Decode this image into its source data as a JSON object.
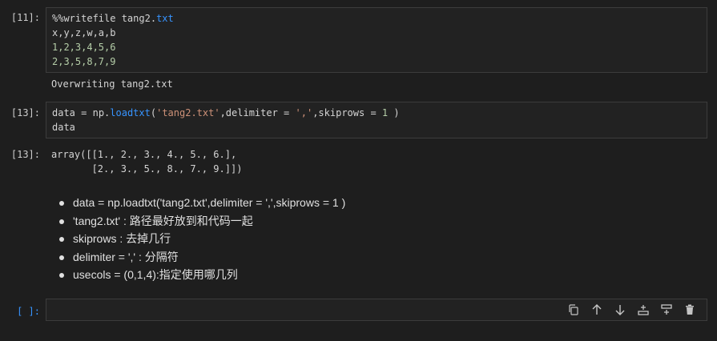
{
  "cells": [
    {
      "prompt": "[11]:",
      "code": {
        "line1_magic": "%%writefile",
        "line1_name": " tang2.",
        "line1_ext": "txt",
        "line2": "x,y,z,w,a,b",
        "line3": "1,2,3,4,5,6",
        "line4": "2,3,5,8,7,9"
      },
      "output": "Overwriting tang2.txt"
    },
    {
      "prompt": "[13]:",
      "code": {
        "var": "data",
        "eq": " = ",
        "mod": "np.",
        "fn": "loadtxt",
        "open": "(",
        "arg1": "'tang2.txt'",
        "kw1": ",delimiter",
        "eq2": " = ",
        "arg2": "','",
        "kw2": ",skiprows",
        "eq3": " = ",
        "arg3": "1",
        "close": " )",
        "line2": "data"
      },
      "output_prompt": "[13]:",
      "output": "array([[1., 2., 3., 4., 5., 6.],\n       [2., 3., 5., 8., 7., 9.]])"
    }
  ],
  "markdown_items": [
    "data = np.loadtxt('tang2.txt',delimiter = ',',skiprows = 1 )",
    "'tang2.txt' :  路径最好放到和代码一起",
    "skiprows : 去掉几行",
    "delimiter = ',' : 分隔符",
    "usecols = (0,1,4):指定使用哪几列"
  ],
  "empty_cell": {
    "prompt": "[ ]:"
  },
  "toolbar": {
    "icons": [
      "copy-icon",
      "move-up-icon",
      "move-down-icon",
      "insert-above-icon",
      "insert-below-icon",
      "delete-icon"
    ]
  },
  "colors": {
    "background": "#1e1e1e",
    "cell_bg": "#222222",
    "accent": "#3794ff",
    "string": "#ce9178",
    "number": "#b5cea8"
  }
}
